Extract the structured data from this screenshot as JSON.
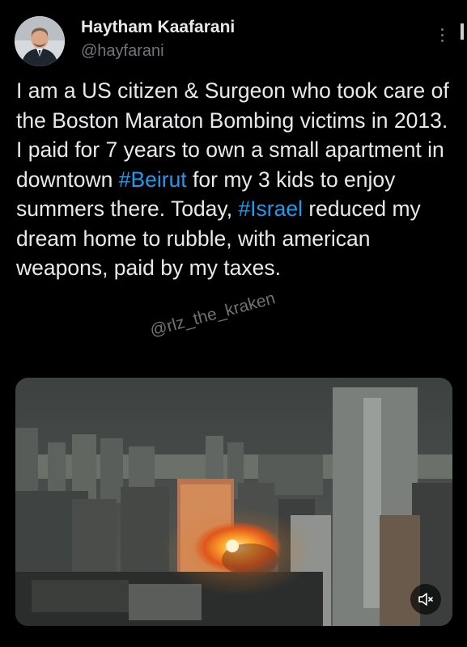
{
  "author": {
    "display_name": "Haytham Kaafarani",
    "handle": "@hayfarani",
    "avatar_icon": "person-avatar-icon"
  },
  "tweet": {
    "text_before_1": "I am a US citizen & Surgeon who took care of the Boston Maraton Bombing victims in 2013. I paid for 7 years to own a small apartment in downtown ",
    "hashtag_1": "#Beirut",
    "text_before_2": " for my 3 kids to enjoy summers there. Today, ",
    "hashtag_2": "#Israel",
    "text_after": " reduced my dream home to rubble, with american weapons, paid by my taxes."
  },
  "watermark": "@rlz_the_kraken",
  "media": {
    "type": "video",
    "description_icon": "city-explosion-video-thumbnail",
    "mute_icon": "volume-muted-icon"
  },
  "colors": {
    "background": "#000000",
    "text": "#e7e9ea",
    "secondary": "#71767b",
    "link": "#1d9bf0"
  }
}
